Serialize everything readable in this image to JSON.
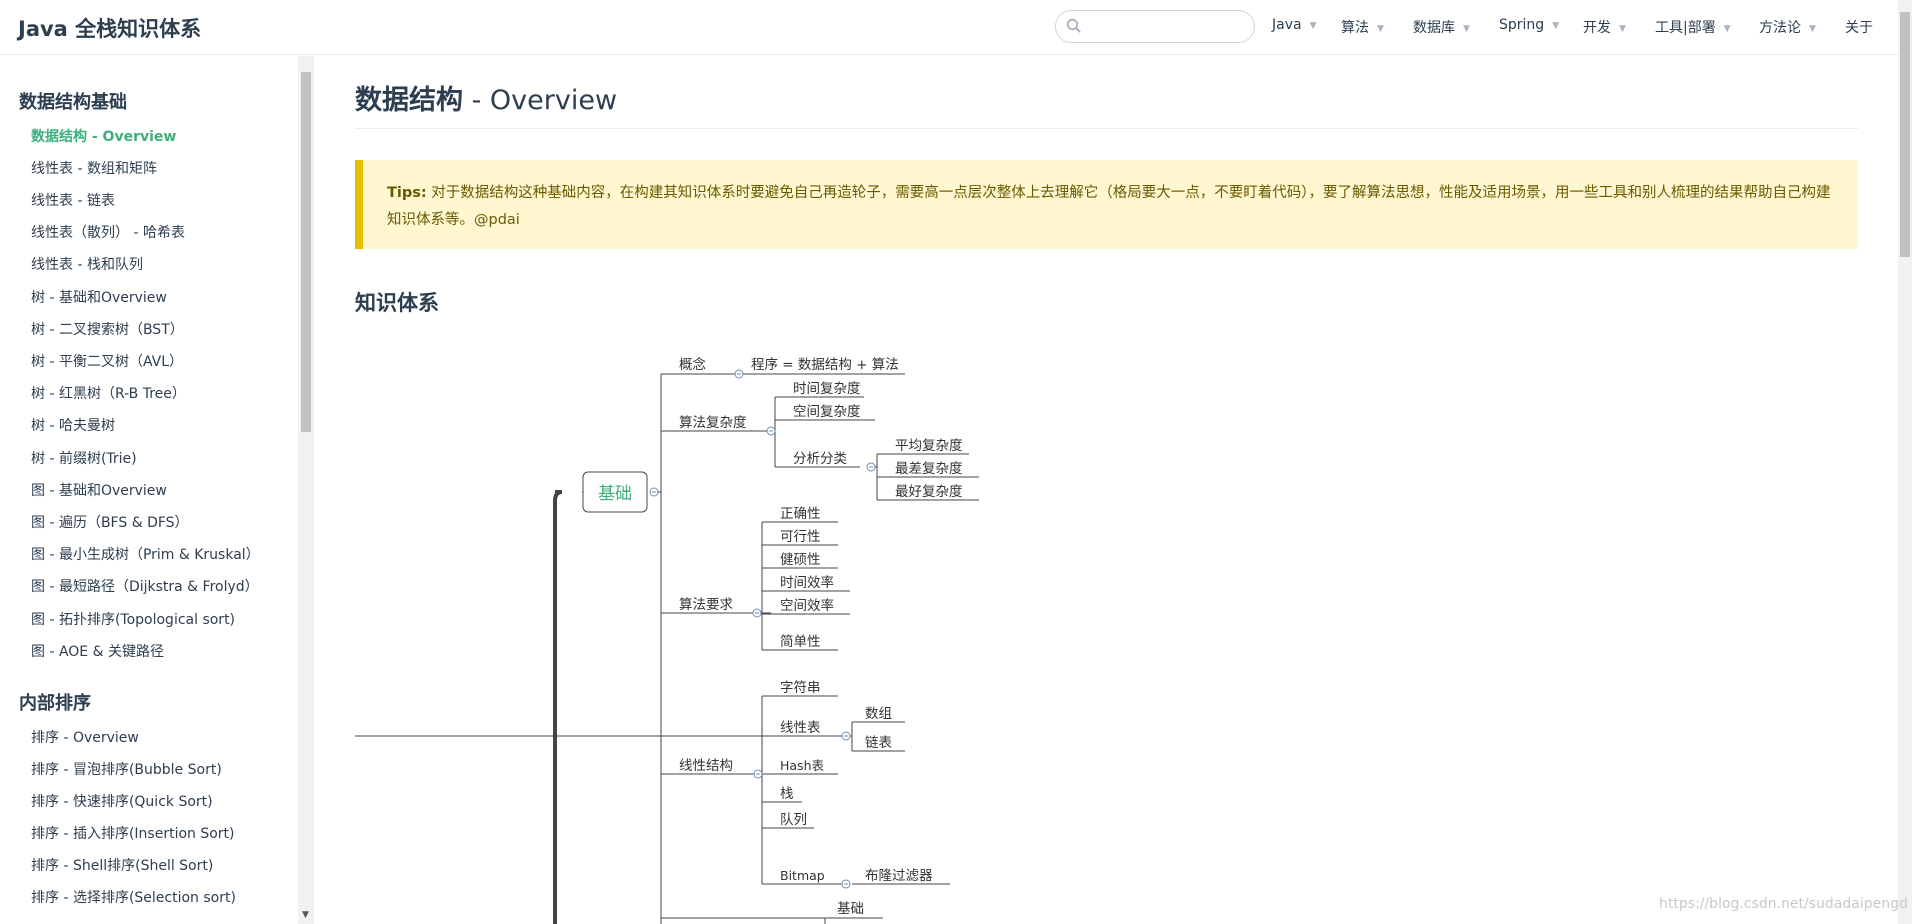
{
  "navbar": {
    "site_title": "Java 全栈知识体系",
    "search": {
      "value": "",
      "placeholder": ""
    },
    "links": [
      {
        "label": "Java",
        "dropdown": true
      },
      {
        "label": "算法",
        "dropdown": true
      },
      {
        "label": "数据库",
        "dropdown": true
      },
      {
        "label": "Spring",
        "dropdown": true
      },
      {
        "label": "开发",
        "dropdown": true
      },
      {
        "label": "工具|部署",
        "dropdown": true
      },
      {
        "label": "方法论",
        "dropdown": true
      },
      {
        "label": "关于",
        "dropdown": false
      }
    ]
  },
  "sidebar": {
    "groups": [
      {
        "title": "数据结构基础",
        "items": [
          "数据结构 - Overview",
          "线性表 - 数组和矩阵",
          "线性表 - 链表",
          "线性表（散列） - 哈希表",
          "线性表 - 栈和队列",
          "树 - 基础和Overview",
          "树 - 二叉搜索树（BST）",
          "树 - 平衡二叉树（AVL）",
          "树 - 红黑树（R-B Tree）",
          "树 - 哈夫曼树",
          "树 - 前缀树(Trie)",
          "图 - 基础和Overview",
          "图 - 遍历（BFS & DFS）",
          "图 - 最小生成树（Prim & Kruskal）",
          "图 - 最短路径（Dijkstra & Frolyd）",
          "图 - 拓扑排序(Topological sort)",
          "图 - AOE & 关键路径"
        ]
      },
      {
        "title": "内部排序",
        "items": [
          "排序 - Overview",
          "排序 - 冒泡排序(Bubble Sort)",
          "排序 - 快速排序(Quick Sort)",
          "排序 - 插入排序(Insertion Sort)",
          "排序 - Shell排序(Shell Sort)",
          "排序 - 选择排序(Selection sort)"
        ]
      }
    ],
    "active_item": "数据结构 - Overview"
  },
  "content": {
    "title_strong": "数据结构",
    "title_rest": " - Overview",
    "tip_label": "Tips:",
    "tip_text": "对于数据结构这种基础内容，在构建其知识体系时要避免自己再造轮子，需要高一点层次整体上去理解它（格局要大一点，不要盯着代码），要了解算法思想，性能及适用场景，用一些工具和别人梳理的结果帮助自己构建知识体系等。@pdai",
    "section_title": "知识体系",
    "mindmap": {
      "root": "基础",
      "concept": {
        "label": "概念",
        "child": "程序 = 数据结构 + 算法"
      },
      "complexity": {
        "label": "算法复杂度",
        "children": [
          "时间复杂度",
          "空间复杂度"
        ],
        "analysis": {
          "label": "分析分类",
          "children": [
            "平均复杂度",
            "最差复杂度",
            "最好复杂度"
          ]
        }
      },
      "requirements": {
        "label": "算法要求",
        "children": [
          "正确性",
          "可行性",
          "健硕性",
          "时间效率",
          "空间效率",
          "简单性"
        ]
      },
      "linear": {
        "label": "线性结构",
        "string": "字符串",
        "list": {
          "label": "线性表",
          "children": [
            "数组",
            "链表"
          ]
        },
        "hash": "Hash表",
        "stack": "栈",
        "queue": "队列",
        "bitmap": {
          "label": "Bitmap",
          "child": "布隆过滤器"
        }
      },
      "next_partial": "基础"
    }
  },
  "watermark": "https://blog.csdn.net/sudadaipengd",
  "colors": {
    "accent": "#3eaf7c",
    "tip_bg": "#fff7d0",
    "tip_border": "#e7c000",
    "text": "#2c3e50"
  }
}
